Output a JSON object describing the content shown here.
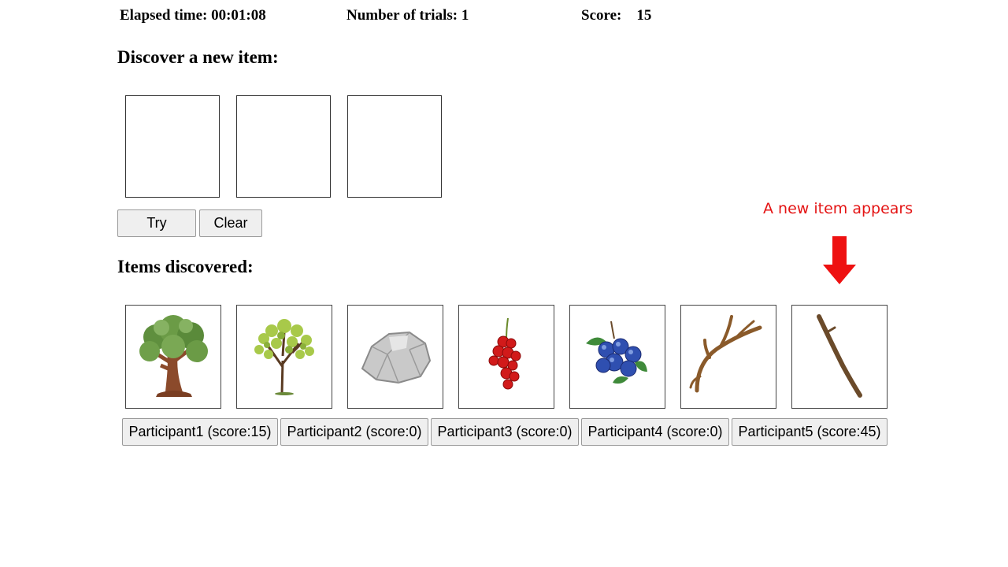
{
  "stats": {
    "elapsed_label": "Elapsed time:",
    "elapsed_value": "00:01:08",
    "trials_label": "Number of trials:",
    "trials_value": "1",
    "score_label": "Score:",
    "score_value": "15"
  },
  "discover": {
    "heading": "Discover a new item:",
    "try_label": "Try",
    "clear_label": "Clear"
  },
  "discovered": {
    "heading": "Items discovered:",
    "items": [
      {
        "icon": "oak-tree-icon"
      },
      {
        "icon": "young-tree-icon"
      },
      {
        "icon": "rock-icon"
      },
      {
        "icon": "red-berries-icon"
      },
      {
        "icon": "blueberries-icon"
      },
      {
        "icon": "antler-icon"
      },
      {
        "icon": "stick-icon"
      }
    ]
  },
  "participants": [
    {
      "label": "Participant1 (score:15)"
    },
    {
      "label": "Participant2 (score:0)"
    },
    {
      "label": "Participant3 (score:0)"
    },
    {
      "label": "Participant4 (score:0)"
    },
    {
      "label": "Participant5 (score:45)"
    }
  ],
  "annotation": {
    "text": "A new item appears",
    "color": "#e41414"
  }
}
